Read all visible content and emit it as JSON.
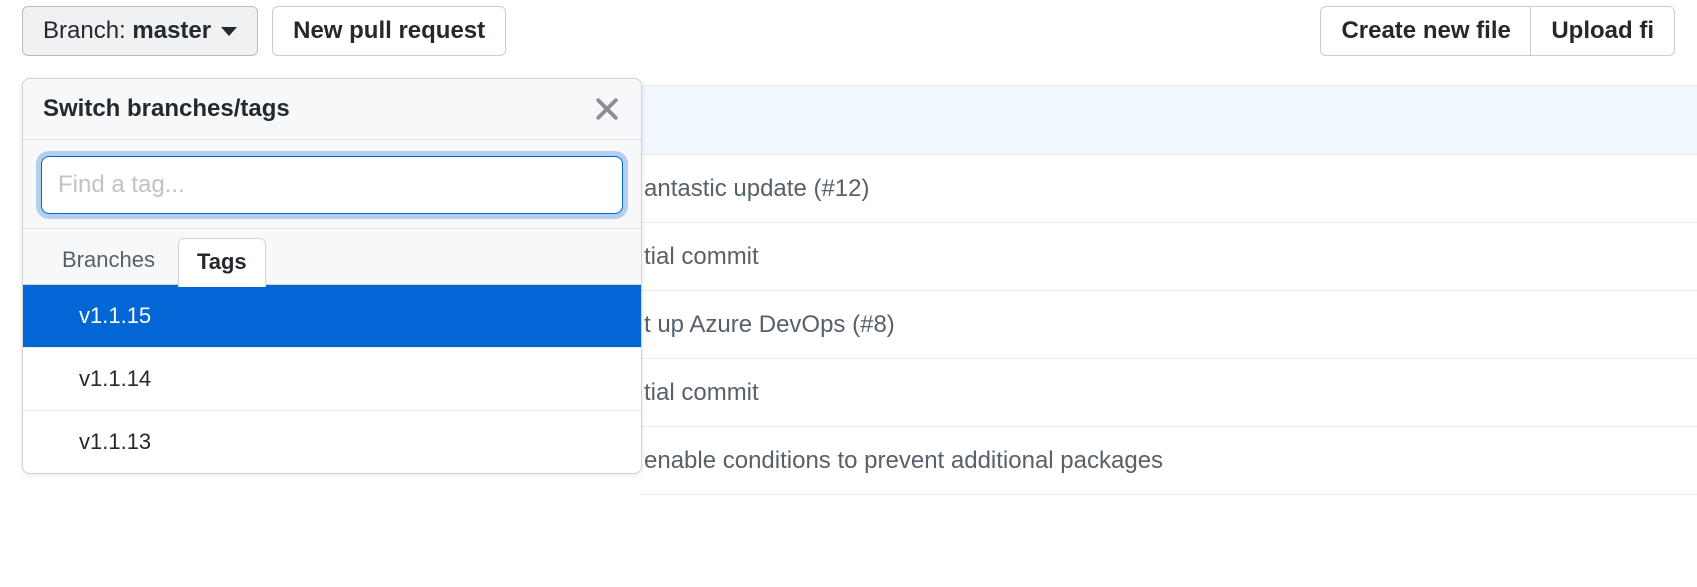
{
  "toolbar": {
    "branch_prefix": "Branch:",
    "branch_name": "master",
    "new_pr_label": "New pull request",
    "create_file_label": "Create new file",
    "upload_label": "Upload fi"
  },
  "popover": {
    "title": "Switch branches/tags",
    "search_placeholder": "Find a tag...",
    "tabs": {
      "branches": "Branches",
      "tags": "Tags",
      "active": "tags"
    },
    "tags": [
      {
        "label": "v1.1.15",
        "selected": true
      },
      {
        "label": "v1.1.14",
        "selected": false
      },
      {
        "label": "v1.1.13",
        "selected": false
      }
    ]
  },
  "commits": [
    "antastic update (#12)",
    "tial commit",
    "t up Azure DevOps (#8)",
    "tial commit",
    "enable conditions to prevent additional packages"
  ]
}
